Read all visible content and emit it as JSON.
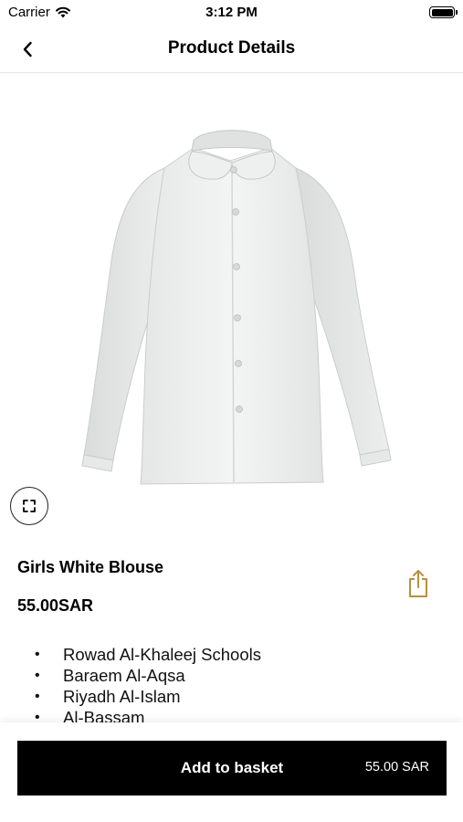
{
  "status_bar": {
    "carrier": "Carrier",
    "time": "3:12 PM",
    "icons": [
      "wifi-icon",
      "battery-icon"
    ]
  },
  "nav": {
    "title": "Product Details",
    "back_icon": "chevron-left-icon"
  },
  "product": {
    "image_icon": "white-blouse-image",
    "expand_icon": "expand-icon",
    "share_icon": "share-icon",
    "name": "Girls White Blouse",
    "price": "55.00SAR",
    "schools": [
      "Rowad Al-Khaleej Schools",
      "Baraem Al-Aqsa",
      "Riyadh Al-Islam",
      "Al-Bassam"
    ]
  },
  "basket_button": {
    "label": "Add to basket",
    "price": "55.00 SAR"
  },
  "colors": {
    "accent": "#b8913a",
    "button_bg": "#000000",
    "text": "#000000"
  }
}
